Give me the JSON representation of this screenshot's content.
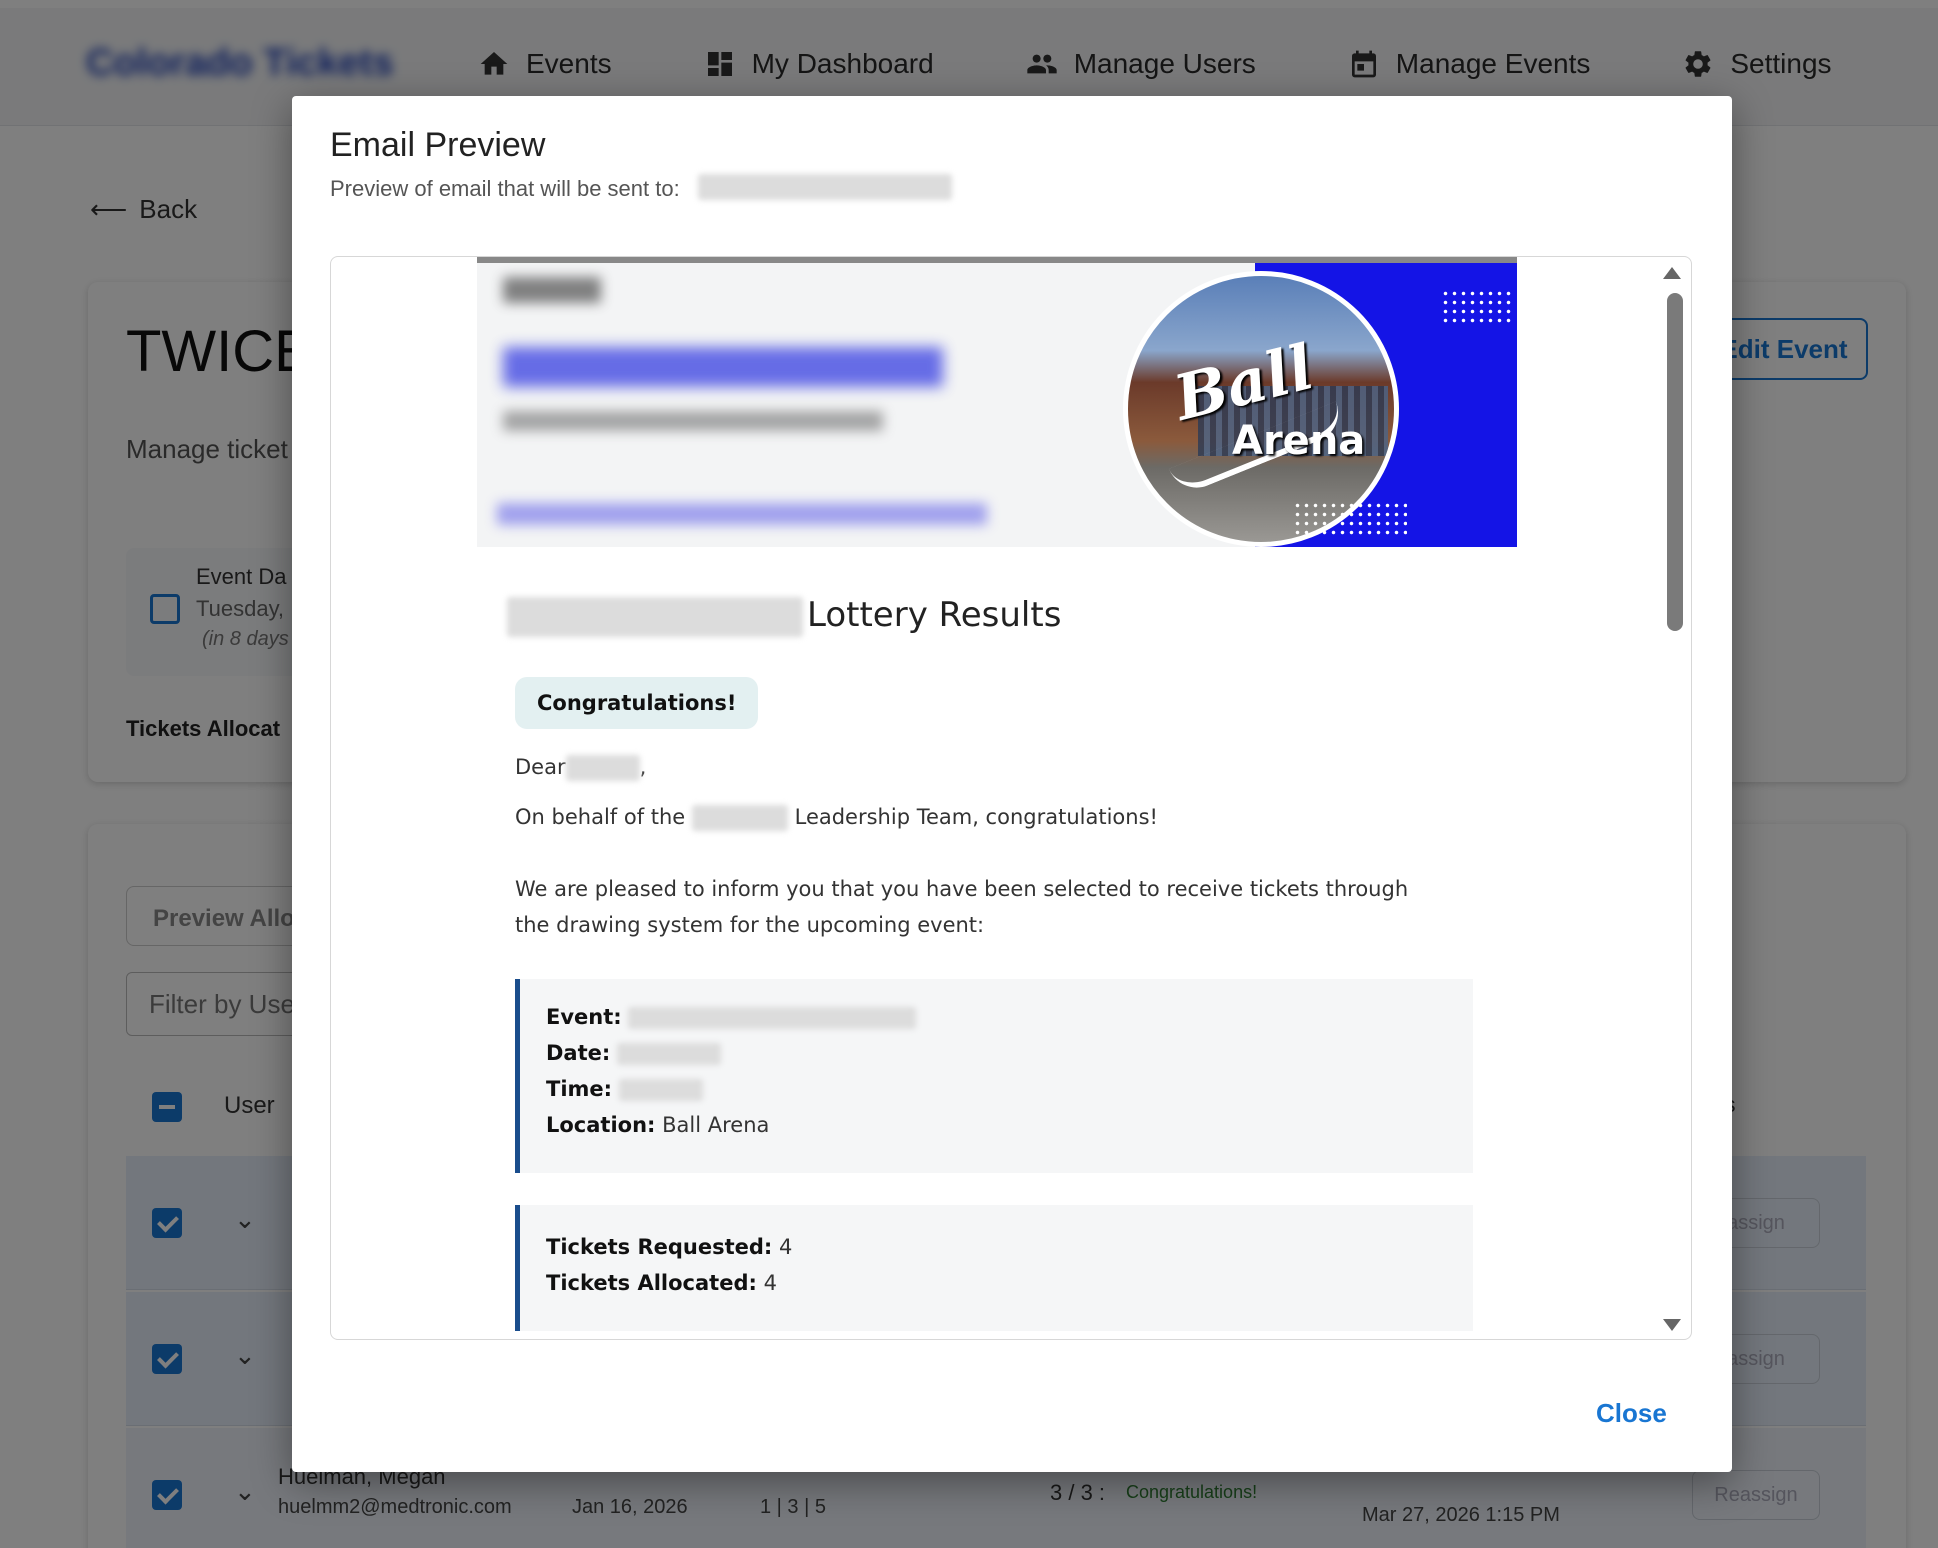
{
  "app": {
    "brand": "Colorado Tickets"
  },
  "nav": [
    {
      "label": "Events",
      "icon": "home-icon"
    },
    {
      "label": "My Dashboard",
      "icon": "dashboard-icon"
    },
    {
      "label": "Manage Users",
      "icon": "users-icon"
    },
    {
      "label": "Manage Events",
      "icon": "calendar-icon"
    },
    {
      "label": "Settings",
      "icon": "gear-icon"
    }
  ],
  "page": {
    "back_label": "Back",
    "event_title": "TWICE",
    "event_subtitle": "Manage ticket",
    "edit_button": "Edit Event",
    "event_date_label": "Event Da",
    "event_date_value": "Tuesday,",
    "event_date_relative": "(in 8 days",
    "tickets_allocated_label": "Tickets Allocat",
    "preview_button": "Preview Allo",
    "filter_placeholder": "Filter by Use",
    "table": {
      "col_user": "User",
      "col_actions": "ons",
      "reassign_label": "assign",
      "reassign_full": "Reassign",
      "row3": {
        "name": "Huelman, Megan",
        "email": "huelmm2@medtronic.com",
        "requested_date": "Jan 16, 2026",
        "counts": "1 | 3 | 5",
        "allocated": "3 / 3 :",
        "status": "Congratulations!",
        "timestamp": "Mar 27, 2026 1:15 PM"
      }
    }
  },
  "modal": {
    "title": "Email Preview",
    "subtitle": "Preview of email that will be sent to:",
    "close_label": "Close",
    "email": {
      "heading": "Lottery Results",
      "congrats_badge": "Congratulations!",
      "greeting": "Dear",
      "behalf_prefix": "On behalf of the",
      "behalf_suffix": "Leadership Team, congratulations!",
      "body": "We are pleased to inform you that you have been selected to receive tickets through the drawing system for the upcoming event:",
      "event_label": "Event:",
      "date_label": "Date:",
      "time_label": "Time:",
      "location_label": "Location:",
      "location_value": "Ball Arena",
      "tickets_requested_label": "Tickets Requested:",
      "tickets_requested_value": "4",
      "tickets_allocated_label": "Tickets Allocated:",
      "tickets_allocated_value": "4",
      "banner_logo_line1": "Ball",
      "banner_logo_line2": "Arena"
    }
  },
  "colors": {
    "primary": "#1976d2",
    "banner_blue": "#1414e6",
    "info_border": "#1a4d8c",
    "badge_bg": "#e3f0f1"
  }
}
